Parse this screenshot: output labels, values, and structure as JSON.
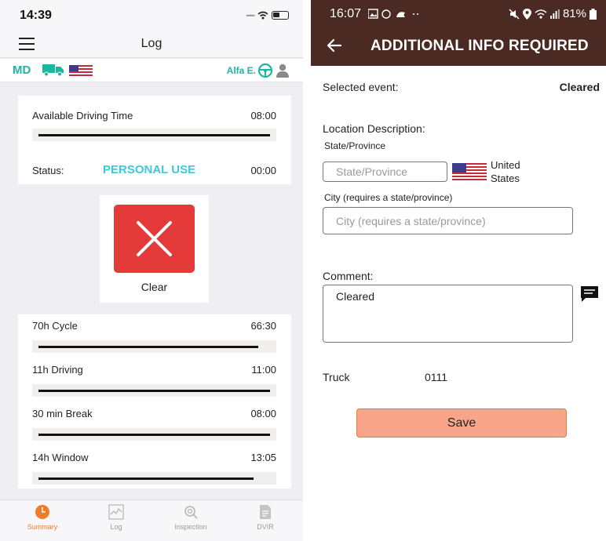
{
  "left": {
    "status_bar": {
      "time": "14:39"
    },
    "nav": {
      "title": "Log"
    },
    "info_bar": {
      "region_code": "MD",
      "driver_name": "Alfa E."
    },
    "available": {
      "label": "Available Driving Time",
      "value": "08:00",
      "fraction": 1.0
    },
    "status": {
      "label": "Status:",
      "value": "PERSONAL USE",
      "time": "00:00"
    },
    "clear": {
      "label": "Clear"
    },
    "counters": [
      {
        "label": "70h Cycle",
        "value": "66:30",
        "fraction": 0.95
      },
      {
        "label": "11h Driving",
        "value": "11:00",
        "fraction": 1.0
      },
      {
        "label": "30 min Break",
        "value": "08:00",
        "fraction": 1.0
      },
      {
        "label": "14h Window",
        "value": "13:05",
        "fraction": 0.93
      }
    ],
    "tabs": [
      {
        "label": "Summary",
        "icon": "clock-icon",
        "active": true
      },
      {
        "label": "Log",
        "icon": "chart-icon",
        "active": false
      },
      {
        "label": "Inspection",
        "icon": "magnifier-icon",
        "active": false
      },
      {
        "label": "DVIR",
        "icon": "document-icon",
        "active": false
      }
    ],
    "colors": {
      "accent": "#1fb6a0",
      "status": "#3cc9d8",
      "clear": "#e53a3a",
      "tab_active": "#f07c2a"
    }
  },
  "right": {
    "status_bar": {
      "time": "16:07",
      "battery": "81%"
    },
    "appbar": {
      "title": "ADDITIONAL INFO REQUIRED"
    },
    "selected_event": {
      "label": "Selected event:",
      "value": "Cleared"
    },
    "location": {
      "heading": "Location Description:",
      "state_label": "State/Province",
      "state_placeholder": "State/Province",
      "country_line1": "United",
      "country_line2": "States",
      "city_label": "City (requires a state/province)",
      "city_placeholder": "City (requires a state/province)"
    },
    "comment": {
      "label": "Comment:",
      "value": "Cleared"
    },
    "truck": {
      "label": "Truck",
      "value": "0111"
    },
    "save": {
      "label": "Save"
    },
    "colors": {
      "appbar": "#4a2a23",
      "save_bg": "#f8a58a",
      "save_border": "#e8773f"
    }
  }
}
